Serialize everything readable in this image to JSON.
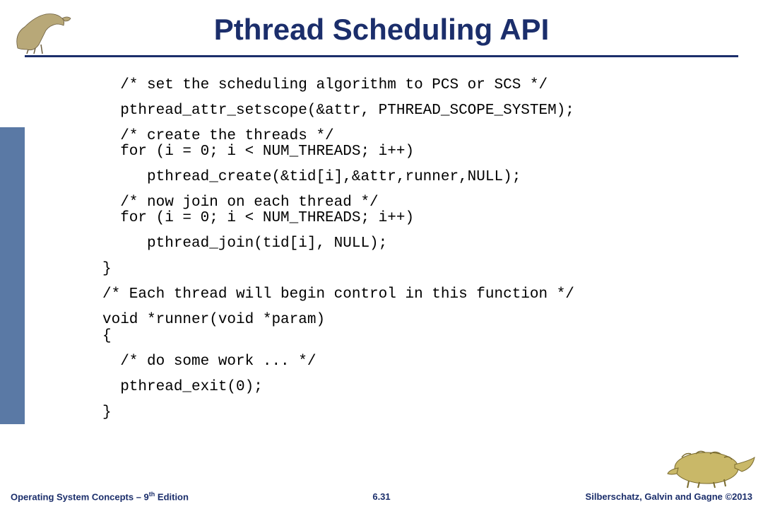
{
  "title": "Pthread Scheduling API",
  "code": {
    "l1": "  /* set the scheduling algorithm to PCS or SCS */",
    "l2": "  pthread_attr_setscope(&attr, PTHREAD_SCOPE_SYSTEM);",
    "l3": "  /* create the threads */",
    "l4": "  for (i = 0; i < NUM_THREADS; i++)",
    "l5": "     pthread_create(&tid[i],&attr,runner,NULL);",
    "l6": "  /* now join on each thread */",
    "l7": "  for (i = 0; i < NUM_THREADS; i++)",
    "l8": "     pthread_join(tid[i], NULL);",
    "l9": "}",
    "l10": "/* Each thread will begin control in this function */",
    "l11": "void *runner(void *param)",
    "l12": "{",
    "l13": "  /* do some work ... */",
    "l14": "  pthread_exit(0);",
    "l15": "}"
  },
  "footer": {
    "left_a": "Operating System Concepts – 9",
    "left_sup": "th",
    "left_b": " Edition",
    "center": "6.31",
    "right": "Silberschatz, Galvin and Gagne ©2013"
  },
  "icons": {
    "dino_top": "dinosaur-ornithomimid-illustration",
    "dino_bottom": "dinosaur-ankylosaur-illustration"
  }
}
